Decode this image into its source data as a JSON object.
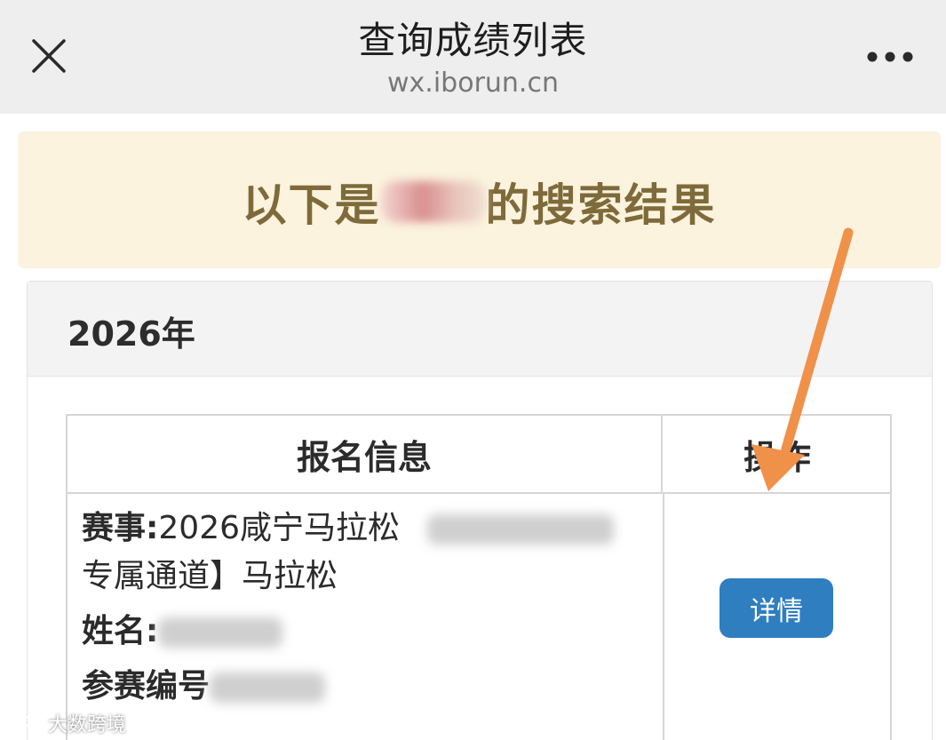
{
  "navbar": {
    "title": "查询成绩列表",
    "subtitle": "wx.iborun.cn"
  },
  "banner": {
    "prefix": "以下是",
    "suffix": "的搜索结果"
  },
  "year_card": {
    "year": "2026年"
  },
  "table": {
    "headers": [
      "报名信息",
      "操作"
    ],
    "row": {
      "event_label": "赛事:",
      "event_value_line1": "2026咸宁马拉松",
      "event_value_line2": "专属通道】马拉松",
      "name_label": "姓名:",
      "bib_label": "参赛编号",
      "action_label": "详情"
    }
  },
  "watermark": "大数跨境",
  "colors": {
    "banner_bg": "#fbf3dd",
    "banner_text": "#7e6a3a",
    "button_bg": "#2f7ec0",
    "arrow": "#f0914a"
  }
}
